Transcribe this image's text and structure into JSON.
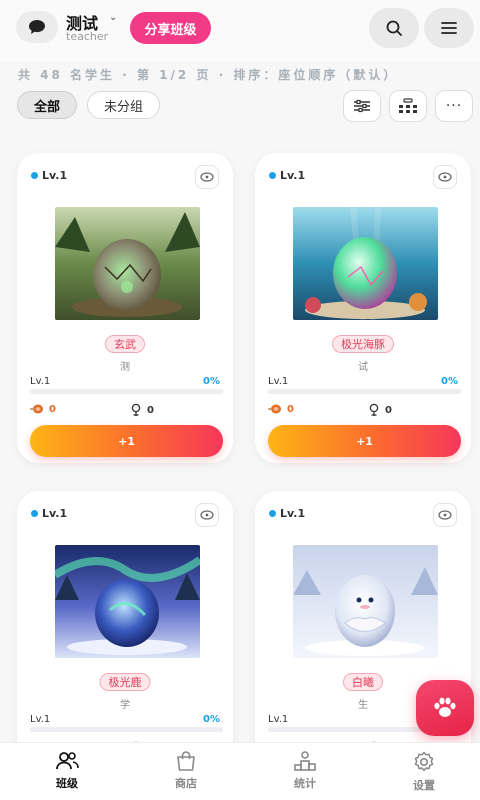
{
  "header": {
    "class_name": "测试",
    "class_role": "teacher",
    "share_label": "分享班级"
  },
  "info_line": "共 48 名学生 · 第 1/2 页 · 排序：座位顺序（默认）",
  "filters": {
    "all_label": "全部",
    "ungrouped_label": "未分组"
  },
  "cards": [
    {
      "level": "Lv.1",
      "pet_name": "玄武",
      "owner": "测",
      "progress_label": "Lv.1",
      "progress_pct": "0%",
      "progress_value": 0,
      "food": "0",
      "rank": "0",
      "plus_label": "+1",
      "theme": "earth"
    },
    {
      "level": "Lv.1",
      "pet_name": "极光海豚",
      "owner": "试",
      "progress_label": "Lv.1",
      "progress_pct": "0%",
      "progress_value": 0,
      "food": "0",
      "rank": "0",
      "plus_label": "+1",
      "theme": "ocean"
    },
    {
      "level": "Lv.1",
      "pet_name": "极光鹿",
      "owner": "学",
      "progress_label": "Lv.1",
      "progress_pct": "0%",
      "progress_value": 0,
      "food": "",
      "rank": "",
      "plus_label": "",
      "theme": "aurora"
    },
    {
      "level": "Lv.1",
      "pet_name": "白曦",
      "owner": "生",
      "progress_label": "Lv.1",
      "progress_pct": "0%",
      "progress_value": 0,
      "food": "",
      "rank": "",
      "plus_label": "",
      "theme": "snow"
    }
  ],
  "nav": {
    "items": [
      {
        "label": "班级",
        "icon": "users-icon",
        "active": true
      },
      {
        "label": "商店",
        "icon": "shop-bag-icon",
        "active": false
      },
      {
        "label": "统计",
        "icon": "podium-icon",
        "active": false
      },
      {
        "label": "设置",
        "icon": "gear-icon",
        "active": false
      }
    ]
  },
  "colors": {
    "accent_pink": "#f23a86",
    "level_blue": "#1aa0e6",
    "button_gradient_start": "#fdb515",
    "button_gradient_end": "#f6375b"
  }
}
